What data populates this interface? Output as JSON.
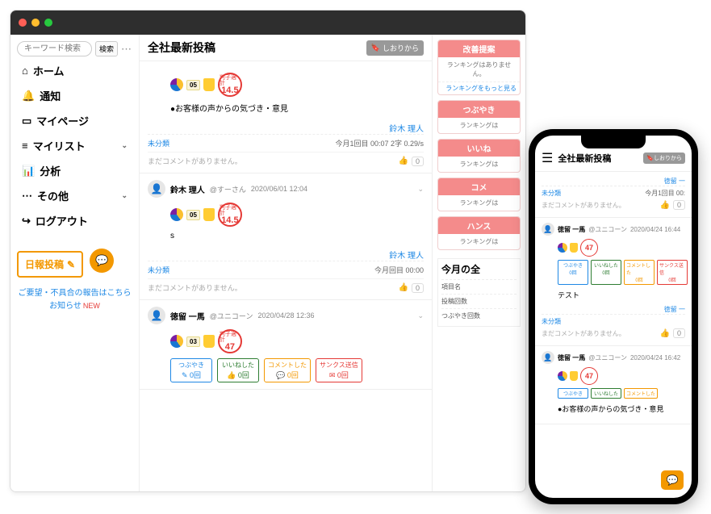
{
  "sidebar": {
    "search_placeholder": "キーワード検索",
    "search_btn": "検索",
    "nav": {
      "home": "ホーム",
      "notify": "通知",
      "mypage": "マイページ",
      "mylist": "マイリスト",
      "analysis": "分析",
      "other": "その他",
      "logout": "ログアウト"
    },
    "post_button": "日報投稿",
    "feedback_link": "ご要望・不具合の報告はこちら",
    "news_link": "お知らせ",
    "new_label": "NEW"
  },
  "feed": {
    "title": "全社最新投稿",
    "bookmark": "しおりから",
    "posts": [
      {
        "score_label": "判子適計",
        "score": "14.5",
        "num_badge": "05",
        "body": "●お客様の声からの気づき・意見",
        "cat": "未分類",
        "author": "鈴木 理人",
        "meta": "今月1回目 00:07 2字 0.29/s",
        "no_comment": "まだコメントがありません。",
        "like": "0"
      },
      {
        "name": "鈴木 理人",
        "handle": "@すーさん",
        "date": "2020/06/01 12:04",
        "score_label": "判子適計",
        "score": "14.5",
        "num_badge": "05",
        "body": "s",
        "cat": "未分類",
        "author": "鈴木 理人",
        "meta": "今月回目 00:00",
        "no_comment": "まだコメントがありません。",
        "like": "0"
      },
      {
        "name": "徳留 一馬",
        "handle": "@ユニコーン",
        "date": "2020/04/28 12:36",
        "score_label": "判子適計",
        "score": "47",
        "num_badge": "03",
        "tags": {
          "t1": "つぶやき",
          "t1c": "0回",
          "t2": "いいねした",
          "t2c": "0回",
          "t3": "コメントした",
          "t3c": "0回",
          "t4": "サンクス送信",
          "t4c": "0回"
        }
      }
    ]
  },
  "rank": {
    "cards": [
      {
        "title": "改善提案",
        "body": "ランキングはありません。",
        "more": "ランキングをもっと見る"
      },
      {
        "title": "つぶやき",
        "body": "ランキングは"
      },
      {
        "title": "いいね",
        "body": "ランキングは"
      },
      {
        "title": "コメ",
        "body": "ランキングは"
      },
      {
        "title": "ハンス",
        "body": "ランキングは"
      }
    ],
    "month_title": "今月の全",
    "month_rows": {
      "r1": "項目名",
      "r2": "投稿回数",
      "r3": "つぶやき回数"
    }
  },
  "phone": {
    "title": "全社最新投稿",
    "bookmark": "しおりから",
    "author_top": "徳留 一",
    "top_cat": "未分類",
    "top_meta": "今月1回目 00:",
    "no_comment": "まだコメントがありません。",
    "like": "0",
    "p1": {
      "name": "徳留 一馬",
      "handle": "@ユニコーン",
      "date": "2020/04/24 16:44",
      "score": "47",
      "tags": {
        "t1": "つぶやき",
        "c1": "0回",
        "t2": "いいねした",
        "c2": "0回",
        "t3": "コメントした",
        "c3": "0回",
        "t4": "サンクス送信",
        "c4": "0回"
      },
      "body": "テスト",
      "author": "徳留 一",
      "cat": "未分類"
    },
    "p2": {
      "name": "徳留 一馬",
      "handle": "@ユニコーン",
      "date": "2020/04/24 16:42",
      "score": "47",
      "tags": {
        "t1": "つぶやき",
        "t2": "いいねした",
        "t3": "コメントした",
        "t4": ""
      },
      "body": "●お客様の声からの気づき・意見"
    }
  }
}
